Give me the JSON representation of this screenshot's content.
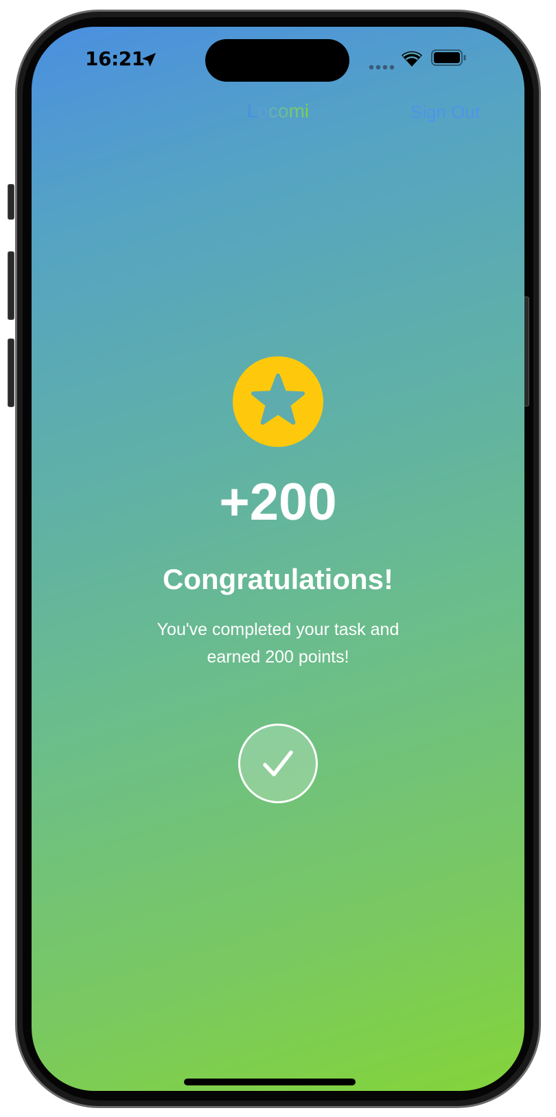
{
  "status_bar": {
    "time": "16:21",
    "icons": [
      "location-arrow-icon",
      "cellular-signal-icon",
      "wifi-icon",
      "battery-icon"
    ]
  },
  "nav": {
    "title_letters": [
      "L",
      "o",
      "c",
      "o",
      "m",
      "i"
    ],
    "title_letter_colors": [
      "#4a8fe0",
      "#5b9fd3",
      "#66b1b4",
      "#6dbc96",
      "#78c86a",
      "#84d43a"
    ],
    "sign_out_label": "Sign Out",
    "sign_out_color": "#4f94e8"
  },
  "reward": {
    "badge_icon": "star-icon",
    "badge_color": "#fec90d",
    "points_label": "+200",
    "heading": "Congratulations!",
    "message": "You've completed your task and earned 200 points!"
  },
  "done_button": {
    "icon": "checkmark-icon"
  }
}
